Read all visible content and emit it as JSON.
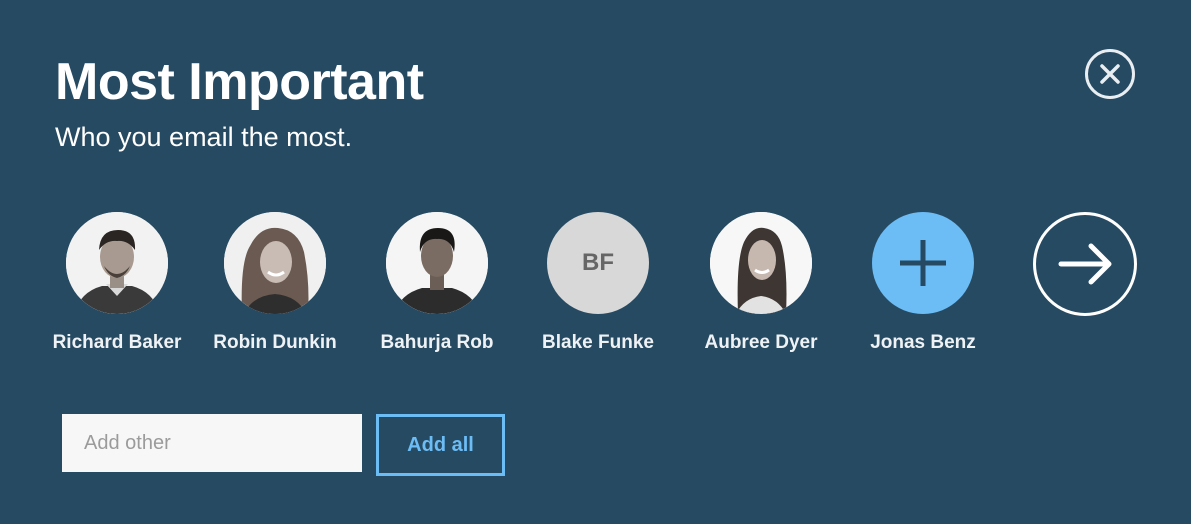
{
  "header": {
    "title": "Most Important",
    "subtitle": "Who you email the most."
  },
  "contacts": [
    {
      "name": "Richard Baker",
      "avatar": "photo"
    },
    {
      "name": "Robin Dunkin",
      "avatar": "photo"
    },
    {
      "name": "Bahurja Rob",
      "avatar": "photo"
    },
    {
      "name": "Blake Funke",
      "avatar": "initials",
      "initials": "BF"
    },
    {
      "name": "Aubree Dyer",
      "avatar": "photo"
    },
    {
      "name": "Jonas Benz",
      "avatar": "add"
    }
  ],
  "controls": {
    "close_icon": "close-circle-icon",
    "next_icon": "arrow-right-circle-icon",
    "add_icon": "plus-icon"
  },
  "add_other": {
    "placeholder": "Add other",
    "value": ""
  },
  "add_all_label": "Add all",
  "colors": {
    "background": "#264a62",
    "accent": "#6cbcf5",
    "initials_bg": "#d8d8d8"
  }
}
